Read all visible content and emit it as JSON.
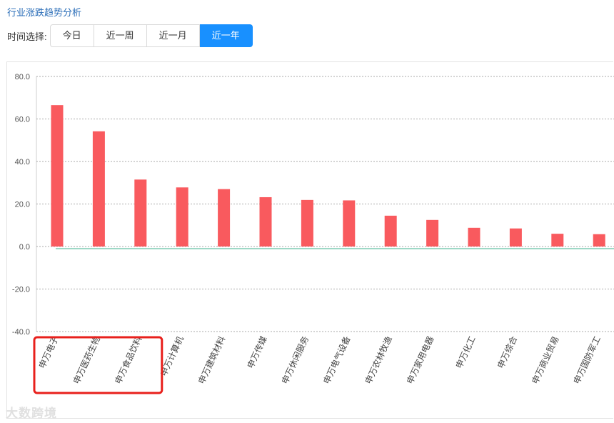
{
  "title": "行业涨跌趋势分析",
  "time_select": {
    "label": "时间选择:",
    "options": [
      "今日",
      "近一周",
      "近一月",
      "近一年"
    ],
    "active": "近一年"
  },
  "watermark": "大数跨境",
  "colors": {
    "bar": "#f95a5e",
    "zero_line": "#7fcbb4",
    "grid": "#aaaaaa",
    "highlight": "#e8201c",
    "active_button": "#1890ff",
    "title": "#2a6db8"
  },
  "chart_data": {
    "type": "bar",
    "title": "",
    "xlabel": "",
    "ylabel": "",
    "ylim": [
      -40,
      80
    ],
    "yticks": [
      "80.0",
      "60.0",
      "40.0",
      "20.0",
      "0.0",
      "-20.0",
      "-40.0"
    ],
    "grid": true,
    "categories": [
      "申万电子",
      "申万医药生物",
      "申万食品饮料",
      "申万计算机",
      "申万建筑材料",
      "申万传媒",
      "申万休闲服务",
      "申万电气设备",
      "申万农林牧渔",
      "申万家用电器",
      "申万化工",
      "申万综合",
      "申万商业贸易",
      "申万国防军工"
    ],
    "values": [
      66.5,
      54.2,
      31.5,
      27.8,
      27.0,
      23.2,
      21.9,
      21.7,
      14.5,
      12.5,
      8.8,
      8.5,
      6.0,
      5.8
    ],
    "highlighted_categories": [
      "申万电子",
      "申万医药生物",
      "申万食品饮料"
    ]
  }
}
